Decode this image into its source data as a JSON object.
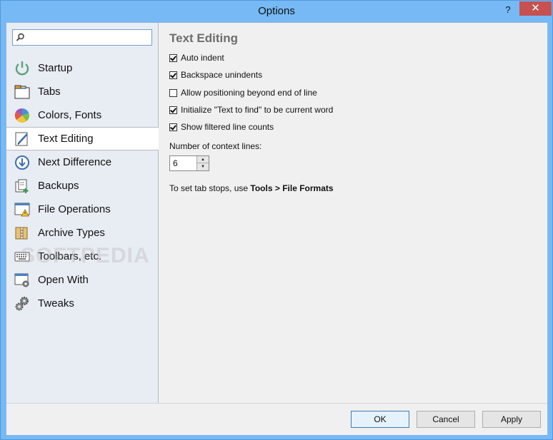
{
  "window": {
    "title": "Options",
    "help_label": "?",
    "close_label": "✕"
  },
  "search": {
    "placeholder": "",
    "value": ""
  },
  "sidebar": {
    "items": [
      {
        "label": "Startup",
        "icon": "power-icon"
      },
      {
        "label": "Tabs",
        "icon": "tabs-icon"
      },
      {
        "label": "Colors, Fonts",
        "icon": "palette-icon"
      },
      {
        "label": "Text Editing",
        "icon": "pencil-icon",
        "selected": true
      },
      {
        "label": "Next Difference",
        "icon": "arrow-down-circle-icon"
      },
      {
        "label": "Backups",
        "icon": "backup-icon"
      },
      {
        "label": "File Operations",
        "icon": "file-warning-icon"
      },
      {
        "label": "Archive Types",
        "icon": "archive-icon"
      },
      {
        "label": "Toolbars, etc.",
        "icon": "keyboard-icon"
      },
      {
        "label": "Open With",
        "icon": "window-gear-icon"
      },
      {
        "label": "Tweaks",
        "icon": "gears-icon"
      }
    ],
    "watermark": "SOFTPEDIA"
  },
  "content": {
    "heading": "Text Editing",
    "options": [
      {
        "label": "Auto indent",
        "checked": true
      },
      {
        "label": "Backspace unindents",
        "checked": true
      },
      {
        "label": "Allow positioning beyond end of line",
        "checked": false
      },
      {
        "label": "Initialize \"Text to find\" to be current word",
        "checked": true
      },
      {
        "label": "Show filtered line counts",
        "checked": true
      }
    ],
    "context_lines_label": "Number of context lines:",
    "context_lines_value": "6",
    "tabstop_prefix": "To set tab stops, use ",
    "tabstop_bold": "Tools > File Formats"
  },
  "footer": {
    "ok_label": "OK",
    "cancel_label": "Cancel",
    "apply_label": "Apply"
  }
}
